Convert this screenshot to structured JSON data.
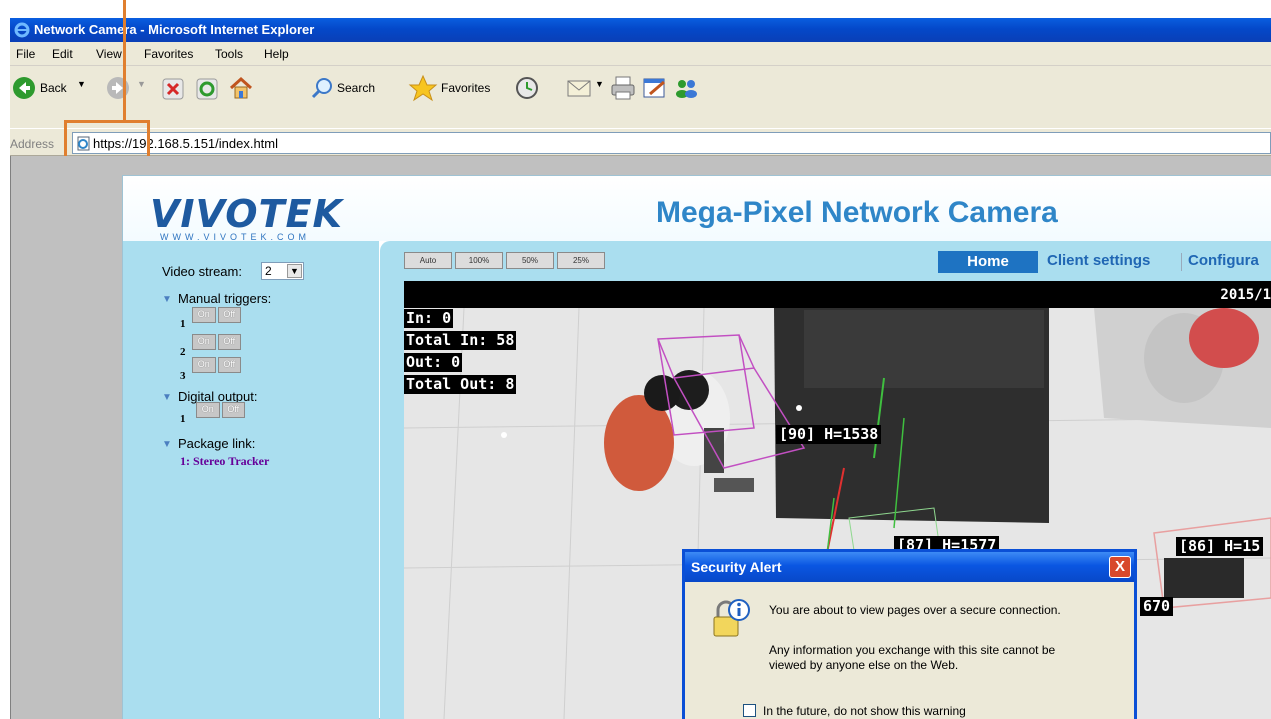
{
  "window": {
    "title": "Network Camera - Microsoft Internet Explorer"
  },
  "menu": [
    "File",
    "Edit",
    "View",
    "Favorites",
    "Tools",
    "Help"
  ],
  "toolbar": {
    "back": "Back",
    "search": "Search",
    "favorites": "Favorites"
  },
  "address": {
    "label": "Address",
    "url": "https://192.168.5.151/index.html"
  },
  "logo": {
    "text": "VIVOTEK",
    "sub": "WWW.VIVOTEK.COM"
  },
  "brand": "Mega-Pixel Network Camera",
  "view_sizes": [
    "Auto",
    "100%",
    "50%",
    "25%"
  ],
  "nav": {
    "home": "Home",
    "client_settings": "Client settings",
    "configuration": "Configura"
  },
  "sidebar": {
    "video_stream_label": "Video stream:",
    "video_stream_value": "2",
    "manual_triggers": "Manual triggers:",
    "trigger_numbers": [
      "1",
      "2",
      "3"
    ],
    "on": "On",
    "off": "Off",
    "digital_output": "Digital output:",
    "digital_output_number": "1",
    "package_link": "Package link:",
    "package_item": "1: Stereo Tracker"
  },
  "video": {
    "timestamp": "2015/1",
    "counts": [
      "In: 0",
      "Total In: 58",
      "Out: 0",
      "Total Out: 8"
    ],
    "tags": [
      "[90] H=1538",
      "[87] H=1577",
      "[86] H=15",
      "670"
    ]
  },
  "dialog": {
    "title": "Security Alert",
    "close": "X",
    "line1": "You are about to view pages over a secure connection.",
    "line2": "Any information you exchange with this site cannot be",
    "line3": "viewed by anyone else on the Web.",
    "checkbox": "In the future, do not show this warning"
  }
}
